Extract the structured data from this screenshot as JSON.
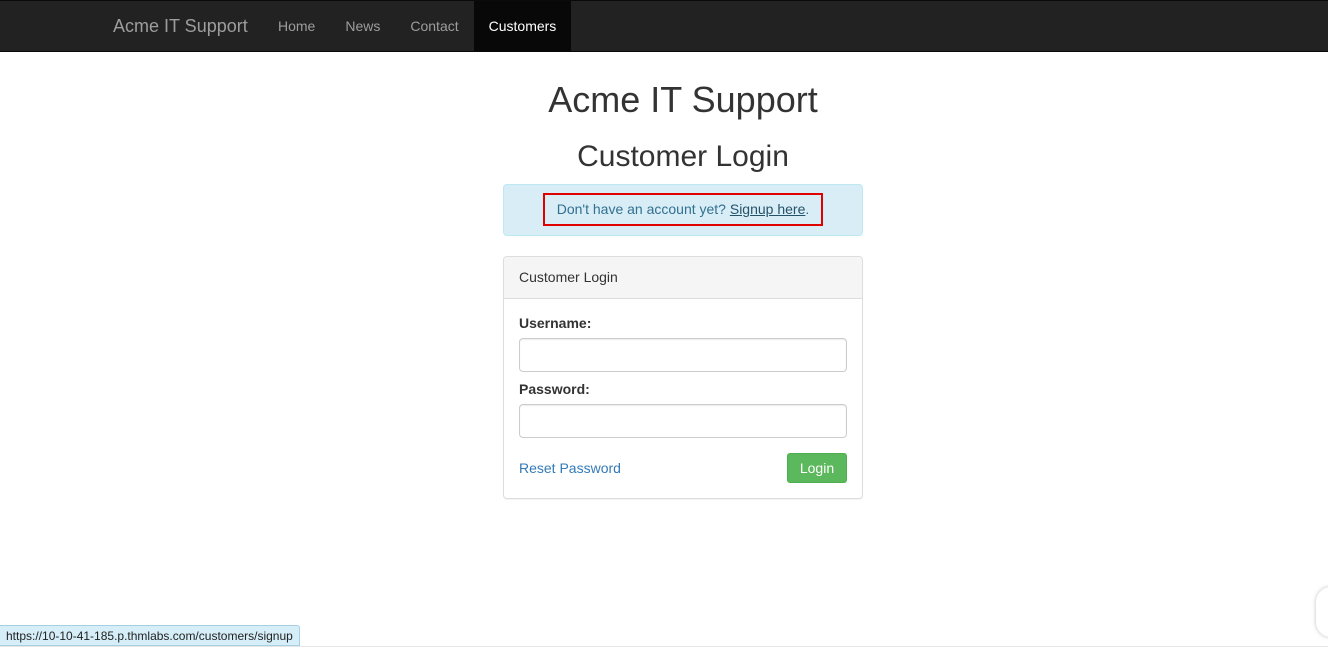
{
  "navbar": {
    "brand": "Acme IT Support",
    "items": [
      {
        "label": "Home",
        "active": false
      },
      {
        "label": "News",
        "active": false
      },
      {
        "label": "Contact",
        "active": false
      },
      {
        "label": "Customers",
        "active": true
      }
    ]
  },
  "page": {
    "title": "Acme IT Support",
    "subtitle": "Customer Login"
  },
  "alert": {
    "text": "Don't have an account yet? ",
    "link_label": "Signup here",
    "suffix": "."
  },
  "login_panel": {
    "heading": "Customer Login",
    "username_label": "Username:",
    "username_value": "",
    "password_label": "Password:",
    "password_value": "",
    "reset_label": "Reset Password",
    "login_label": "Login"
  },
  "status_bar": {
    "url": "https://10-10-41-185.p.thmlabs.com/customers/signup"
  },
  "colors": {
    "navbar_bg": "#222222",
    "alert_bg": "#d9edf7",
    "alert_text": "#31708f",
    "highlight_border": "#e00000",
    "link": "#337ab7",
    "button_success": "#5cb85c"
  }
}
